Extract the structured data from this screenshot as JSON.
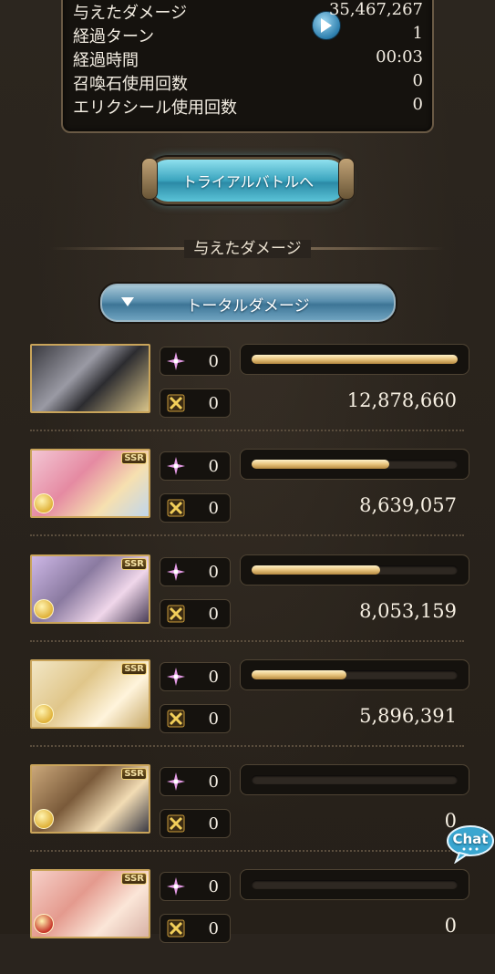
{
  "stats": [
    {
      "label": "与えたダメージ",
      "value": "35,467,267"
    },
    {
      "label": "経過ターン",
      "value": "1"
    },
    {
      "label": "経過時間",
      "value": "00:03"
    },
    {
      "label": "召喚石使用回数",
      "value": "0"
    },
    {
      "label": "エリクシール使用回数",
      "value": "0"
    }
  ],
  "trial_button": "トライアルバトルへ",
  "section_title": "与えたダメージ",
  "dropdown": {
    "selected": "トータルダメージ"
  },
  "rows": [
    {
      "ssr": "",
      "ougi_count": "0",
      "special_count": "0",
      "damage": "12,878,660",
      "bar_fraction": 1.0
    },
    {
      "ssr": "SSR",
      "ougi_count": "0",
      "special_count": "0",
      "damage": "8,639,057",
      "bar_fraction": 0.67
    },
    {
      "ssr": "SSR",
      "ougi_count": "0",
      "special_count": "0",
      "damage": "8,053,159",
      "bar_fraction": 0.625
    },
    {
      "ssr": "SSR",
      "ougi_count": "0",
      "special_count": "0",
      "damage": "5,896,391",
      "bar_fraction": 0.458
    },
    {
      "ssr": "SSR",
      "ougi_count": "0",
      "special_count": "0",
      "damage": "0",
      "bar_fraction": 0
    },
    {
      "ssr": "SSR",
      "ougi_count": "0",
      "special_count": "0",
      "damage": "0",
      "bar_fraction": 0
    }
  ],
  "chat_button": "Chat",
  "colors": {
    "accent_gold": "#e8c47e",
    "button_blue": "#3aa4be"
  }
}
